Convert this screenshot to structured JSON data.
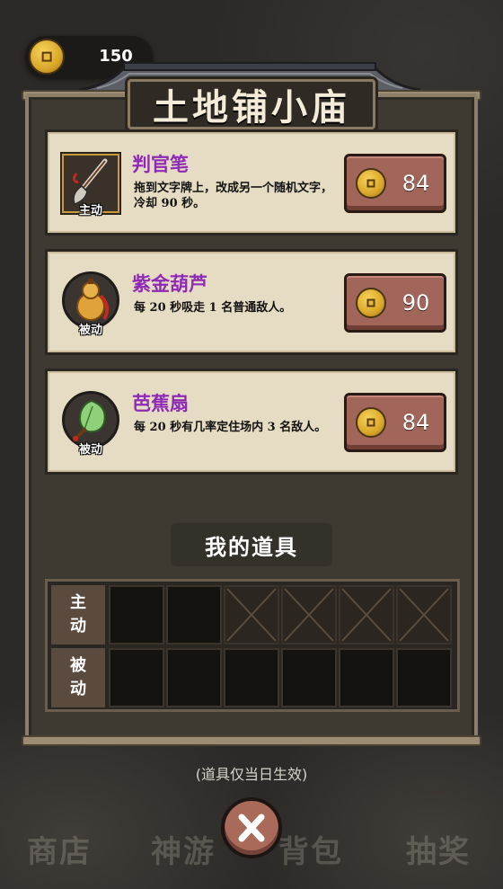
{
  "currency": {
    "icon": "coin-icon",
    "amount": "150"
  },
  "shop": {
    "title": "土地铺小庙"
  },
  "items": [
    {
      "name": "判官笔",
      "tag": "主动",
      "desc": "拖到文字牌上，改成另一个随机文字，冷却 90 秒。",
      "price": "84",
      "icon": "brush-icon"
    },
    {
      "name": "紫金葫芦",
      "tag": "被动",
      "desc": "每 20 秒吸走 1 名普通敌人。",
      "price": "90",
      "icon": "gourd-icon"
    },
    {
      "name": "芭蕉扇",
      "tag": "被动",
      "desc": "每 20 秒有几率定住场内 3 名敌人。",
      "price": "84",
      "icon": "fan-icon"
    }
  ],
  "inventory": {
    "title": "我的道具",
    "rows": [
      {
        "label_1": "主",
        "label_2": "动"
      },
      {
        "label_1": "被",
        "label_2": "动"
      }
    ]
  },
  "note": "(道具仅当日生效)",
  "nav": {
    "shop": "商店",
    "travel": "神游",
    "bag": "背包",
    "lottery": "抽奖"
  },
  "colors": {
    "item_name": "#8e2ab5",
    "buy_button": "#a1655a",
    "card_bg": "#e6dcc3"
  }
}
